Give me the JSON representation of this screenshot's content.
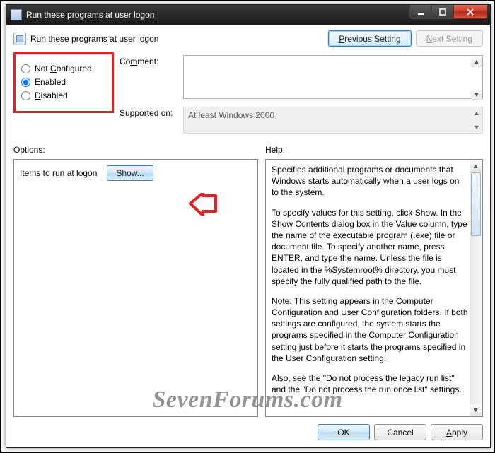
{
  "window": {
    "title": "Run these programs at user logon"
  },
  "header": {
    "policy_title": "Run these programs at user logon",
    "prev_html": "<u>P</u>revious Setting",
    "next_html": "<u>N</u>ext Setting"
  },
  "state": {
    "options": [
      {
        "key": "not_configured",
        "label_html": "Not <u>C</u>onfigured",
        "checked": false
      },
      {
        "key": "enabled",
        "label_html": "<u>E</u>nabled",
        "checked": true
      },
      {
        "key": "disabled",
        "label_html": "<u>D</u>isabled",
        "checked": false
      }
    ]
  },
  "fields": {
    "comment_label_html": "Co<u>m</u>ment:",
    "comment_value": "",
    "supported_label": "Supported on:",
    "supported_value": "At least Windows 2000"
  },
  "section_labels": {
    "options": "Options:",
    "help": "Help:"
  },
  "options_panel": {
    "item_label": "Items to run at logon",
    "show_button": "Show..."
  },
  "help_text": {
    "p1": "Specifies additional programs or documents that Windows starts automatically when a user logs on to the system.",
    "p2": "To specify values for this setting, click Show. In the Show Contents dialog box in the Value column, type the name of the executable program (.exe) file or document file. To specify another name, press ENTER, and type the name. Unless the file is located in the %Systemroot% directory, you must specify the fully qualified path to the file.",
    "p3": "Note: This setting appears in the Computer Configuration and User Configuration folders. If both settings are configured, the system starts the programs specified in the Computer Configuration setting just before it starts the programs specified in the User Configuration setting.",
    "p4": "Also, see the \"Do not process the legacy run list\" and the \"Do not process the run once list\" settings."
  },
  "footer": {
    "ok": "OK",
    "cancel": "Cancel",
    "apply_html": "<u>A</u>pply"
  },
  "watermark": "SevenForums.com"
}
